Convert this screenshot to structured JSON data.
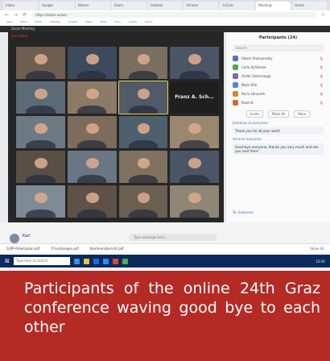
{
  "browser": {
    "tabs": [
      "Inbox",
      "Google",
      "Nature",
      "Zoom",
      "Outlook",
      "Scholar",
      "CoCalc",
      "Meeting",
      "Home"
    ],
    "url": "https://zoom.us/wc/",
    "bookmarks": [
      "Apps",
      "Email",
      "Drive",
      "Calendar",
      "Scholar",
      "News",
      "Maps",
      "Docs",
      "Sheets",
      "Teams"
    ]
  },
  "app": {
    "title": "Zoom Meeting",
    "recording": "Recording"
  },
  "video": {
    "text_tile": "Franz A. Sch..."
  },
  "panel": {
    "title": "Participants (24)",
    "search_placeholder": "Search",
    "participants": [
      {
        "name": "Alexei Ananyevskiy",
        "color": "#5b6fb5",
        "icon": "mic"
      },
      {
        "name": "Carla Schlösser",
        "color": "#55a35b",
        "icon": "mic"
      },
      {
        "name": "Ander Ostervange",
        "color": "#7e6aa8",
        "icon": "mic"
      },
      {
        "name": "Mark Ofer",
        "color": "#4a8bc9",
        "icon": "mic"
      },
      {
        "name": "Karin Lönnroth",
        "color": "#c28d2f",
        "icon": "mic"
      },
      {
        "name": "Pavel K.",
        "color": "#d26a2e",
        "icon": "mic"
      }
    ],
    "buttons": [
      "Invite",
      "Mute All",
      "More"
    ],
    "chat": [
      {
        "from": "Johannes to everyone",
        "text": "Thank you for all your work!"
      },
      {
        "from": "Anna to everyone",
        "text": "Good bye everyone, thanks you very much and see you next time!"
      }
    ],
    "to_label": "To: Everyone"
  },
  "controls": {
    "user_name": "Karl",
    "chat_placeholder": "Type message here..."
  },
  "downloads": [
    "3LPP-Arbeitsplan.pdf",
    "IT-Leistungen.pdf",
    "Konferenzbericht.pdf"
  ],
  "downloads_all": "Show all",
  "taskbar": {
    "search_placeholder": "Type here to search",
    "time": "12:41"
  },
  "caption": "Participants of the online 24th Graz conference waving good bye to each other",
  "tile_colors": [
    "#6f5d4f",
    "#3d4a5e",
    "#7b6f61",
    "#4b5565",
    "#5c6a78",
    "#8a7a66",
    "#505a68",
    "#1f1f1f",
    "#6d7a84",
    "#7d6c5c",
    "#4e5f6e",
    "#9a8770",
    "#5a4f47",
    "#6a7684",
    "#807260",
    "#4a5666",
    "#7e8a95",
    "#5d5148",
    "#6b6052",
    "#8f8676"
  ]
}
